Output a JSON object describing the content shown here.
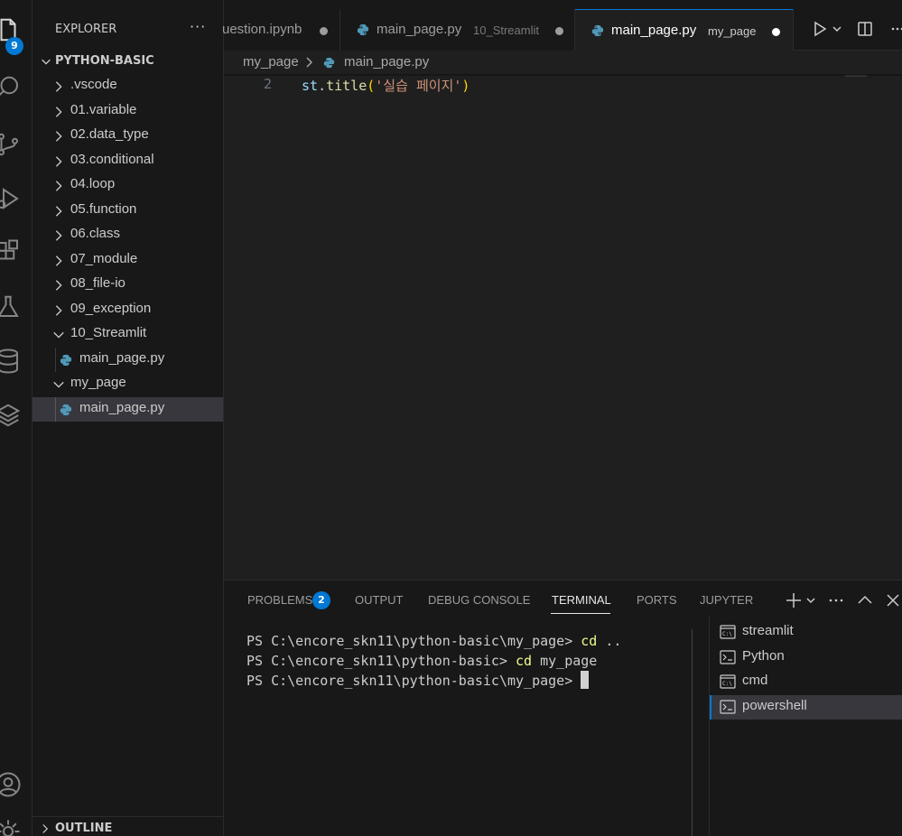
{
  "activity": {
    "explorer_badge": "9"
  },
  "sidebar": {
    "title": "EXPLORER",
    "more": "···",
    "root": "PYTHON-BASIC",
    "items": [
      {
        "label": ".vscode",
        "kind": "folder",
        "expanded": false
      },
      {
        "label": "01.variable",
        "kind": "folder",
        "expanded": false
      },
      {
        "label": "02.data_type",
        "kind": "folder",
        "expanded": false
      },
      {
        "label": "03.conditional",
        "kind": "folder",
        "expanded": false
      },
      {
        "label": "04.loop",
        "kind": "folder",
        "expanded": false
      },
      {
        "label": "05.function",
        "kind": "folder",
        "expanded": false
      },
      {
        "label": "06.class",
        "kind": "folder",
        "expanded": false
      },
      {
        "label": "07_module",
        "kind": "folder",
        "expanded": false
      },
      {
        "label": "08_file-io",
        "kind": "folder",
        "expanded": false
      },
      {
        "label": "09_exception",
        "kind": "folder",
        "expanded": false
      },
      {
        "label": "10_Streamlit",
        "kind": "folder",
        "expanded": true
      },
      {
        "label": "main_page.py",
        "kind": "file"
      },
      {
        "label": "my_page",
        "kind": "folder",
        "expanded": true
      },
      {
        "label": "main_page.py",
        "kind": "file",
        "selected": true
      }
    ],
    "outline": "OUTLINE"
  },
  "tabs": [
    {
      "name": "uestion.ipynb",
      "desc": "",
      "modified": true,
      "active": false
    },
    {
      "name": "main_page.py",
      "desc": "10_Streamlit",
      "modified": true,
      "active": false
    },
    {
      "name": "main_page.py",
      "desc": "my_page",
      "modified": true,
      "active": true
    }
  ],
  "breadcrumb": {
    "folder": "my_page",
    "file": "main_page.py"
  },
  "editor": {
    "line_number": "2",
    "code": {
      "obj": "st",
      "dot": ".",
      "fn": "title",
      "open": "(",
      "str": "'실습 페이지'",
      "close": ")"
    }
  },
  "panel": {
    "tabs": {
      "problems": "PROBLEMS",
      "problems_count": "2",
      "output": "OUTPUT",
      "debug": "DEBUG CONSOLE",
      "terminal": "TERMINAL",
      "ports": "PORTS",
      "jupyter": "JUPYTER"
    },
    "terminal_lines": [
      {
        "prompt": "PS C:\\encore_skn11\\python-basic\\my_page> ",
        "cmd": "cd",
        "arg": " .."
      },
      {
        "prompt": "PS C:\\encore_skn11\\python-basic> ",
        "cmd": "cd",
        "arg": " my_page"
      },
      {
        "prompt": "PS C:\\encore_skn11\\python-basic\\my_page> ",
        "cmd": "",
        "arg": ""
      }
    ],
    "terminals": [
      {
        "label": "streamlit",
        "icon": "cmd-icon"
      },
      {
        "label": "Python",
        "icon": "shell-icon"
      },
      {
        "label": "cmd",
        "icon": "cmd-icon"
      },
      {
        "label": "powershell",
        "icon": "shell-icon",
        "active": true
      }
    ]
  },
  "colors": {
    "accent": "#0078d4",
    "background": "#1f1f1f",
    "sidebar": "#181818"
  }
}
